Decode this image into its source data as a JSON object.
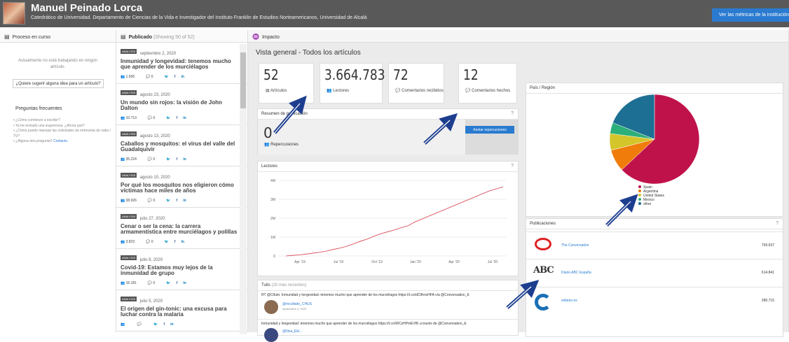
{
  "header": {
    "name": "Manuel Peinado Lorca",
    "affiliation": "Catedrático de Universidad. Departamento de Ciencias de la Vida e Investigador del Instituto Franklin de Estudios Norteamericanos, Universidad de Alcalá",
    "metrics_button": "Ver las métricas de la institución"
  },
  "left": {
    "title": "Proceso en curso",
    "empty_text": "Actualmente no está trabajando en ningún artículo.",
    "suggest_button": "¿Quiere sugerir alguna idea para un artículo?",
    "faq_title": "Preguntas frecuentes",
    "faq": [
      "¿Cómo comienzo a escribir?",
      "Ya he enviado una sugerencia. ¿Ahora qué?",
      "¿Cómo puedo manejar las solicitudes de entrevista de radio / TV?"
    ],
    "faq_last_prefix": "¿Alguna otra pregunta?",
    "faq_contact": "Contacto."
  },
  "published": {
    "title": "Publicado",
    "showing": "(Showing 50 of 52)",
    "badge": "ANALYSIS",
    "articles": [
      {
        "date": "septiembre 2, 2020",
        "title": "Inmunidad y longevidad: tenemos mucho que aprender de los murciélagos",
        "reads": "1.565",
        "comments": "0"
      },
      {
        "date": "agosto 23, 2020",
        "title": "Un mundo sin rojos: la visión de John Dalton",
        "reads": "10.713",
        "comments": "0"
      },
      {
        "date": "agosto 13, 2020",
        "title": "Caballos y mosquitos: el virus del valle del Guadalquivir",
        "reads": "35.224",
        "comments": "0"
      },
      {
        "date": "agosto 10, 2020",
        "title": "Por qué los mosquitos nos eligieron cómo víctimas hace miles de años",
        "reads": "38.926",
        "comments": "0"
      },
      {
        "date": "julio 27, 2020",
        "title": "Cenar o ser la cena: la carrera armamentística entre murciélagos y polillas",
        "reads": "3.823",
        "comments": "0"
      },
      {
        "date": "julio 8, 2020",
        "title": "Covid-19: Estamos muy lejos de la inmunidad de grupo",
        "reads": "16.181",
        "comments": "0"
      },
      {
        "date": "julio 5, 2020",
        "title": "El origen del gin-tonic: una excusa para luchar contra la malaria",
        "reads": "",
        "comments": ""
      }
    ],
    "tw": "🐦",
    "fb": "f",
    "li": "in"
  },
  "impact": {
    "title": "Impacto",
    "overview": "Vista general - Todos los artículos",
    "kpis": [
      {
        "num": "52",
        "label": "Artículos"
      },
      {
        "num": "3.664.783",
        "label": "Lectores"
      },
      {
        "num": "72",
        "label": "Comentarios recibidos"
      },
      {
        "num": "12",
        "label": "Comentarios hechos"
      }
    ],
    "summary_title": "Resumen de publicación",
    "reper_num": "0",
    "reper_label": "Repercusiones",
    "annotate_button": "Anotar repercusiones",
    "readers_title": "Lectores",
    "tweets_title": "Tuits",
    "tweets_sub": "(20 más recientes)",
    "tweet1": "RT @Cifuto: Inmunidad y longevidad: tenemos mucho que aprender de los murciélagos https://t.co/dC9hnxHFA vía @Conversation_E",
    "tweet1_user": "@mcollado_CHUS",
    "tweet1_date": "septiembre 3, 2020",
    "tweet2": "Inmunidad y longevidad: tenemos mucho que aprender de los murciélagos https://t.co/WCzHPmEVfK a través de @Conversation_E",
    "tweet2_user": "@Noa_Ekl...",
    "country_title": "País / Región",
    "pub_title": "Publicaciones",
    "pubs": [
      {
        "name": "The Conversation",
        "value": "793.637"
      },
      {
        "name": "Diario ABC España",
        "value": "614.841"
      },
      {
        "name": "eldiario.es",
        "value": "280.715"
      }
    ],
    "abc_logo": "ABC",
    "help": "?"
  },
  "chart_data": [
    {
      "type": "line",
      "title": "Lectores",
      "x": [
        "Apr '19",
        "Jul '19",
        "Oct '19",
        "Jan '20",
        "Apr '20",
        "Jul '20"
      ],
      "yticks": [
        "0",
        "1M",
        "2M",
        "3M",
        "4M"
      ],
      "ylim": [
        0,
        4000000
      ],
      "series": [
        {
          "values": [
            0,
            30000,
            60000,
            100000,
            150000,
            200000,
            260000,
            350000,
            420000,
            520000,
            650000,
            780000,
            900000,
            1050000,
            1180000,
            1280000,
            1380000,
            1500000,
            1600000,
            1800000,
            1950000,
            2100000,
            2250000,
            2400000,
            2550000,
            2700000,
            2850000,
            3000000,
            3150000,
            3300000,
            3450000,
            3550000,
            3665000
          ]
        }
      ]
    },
    {
      "type": "pie",
      "title": "País / Región",
      "categories": [
        "Spain",
        "Argentina",
        "United States",
        "Mexico",
        "other"
      ],
      "values": [
        63,
        8,
        6,
        4,
        19
      ],
      "colors": [
        "#c0124a",
        "#f07c0b",
        "#d4c52a",
        "#2daf7a",
        "#1d6f94"
      ]
    }
  ]
}
